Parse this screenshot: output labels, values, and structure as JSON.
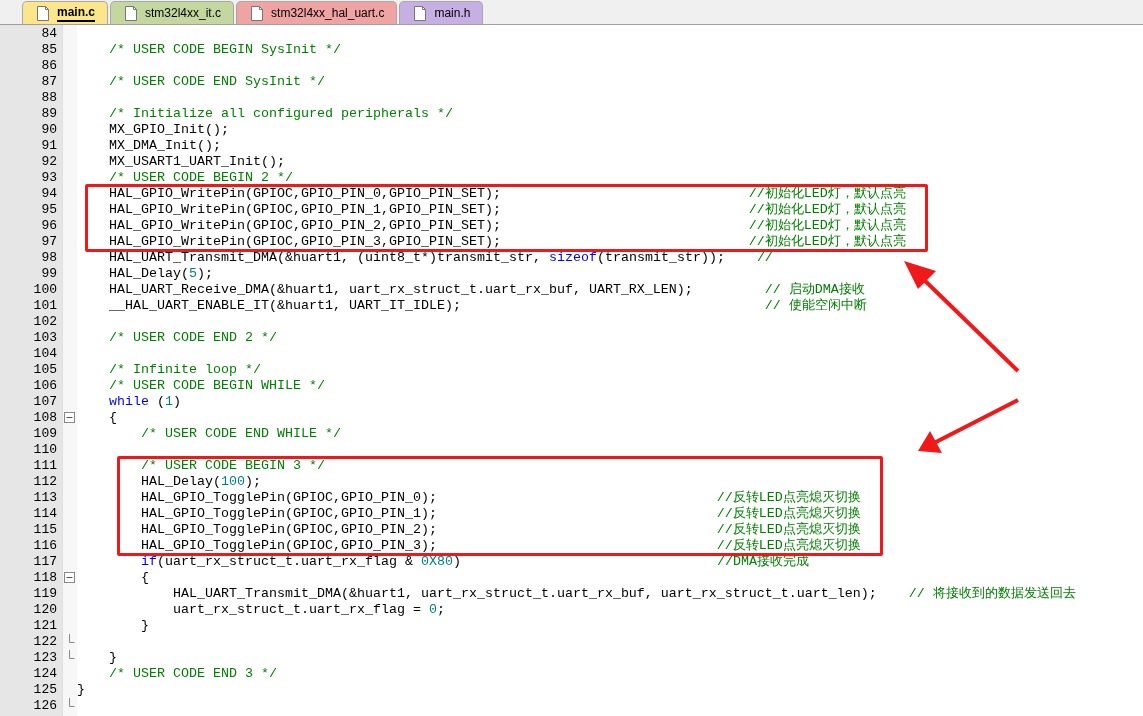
{
  "tabs": [
    {
      "label": "main.c",
      "selected": true,
      "color": "#fce68b"
    },
    {
      "label": "stm32l4xx_it.c",
      "selected": false,
      "color": "#c4d79f"
    },
    {
      "label": "stm32l4xx_hal_uart.c",
      "selected": false,
      "color": "#f0a3a3"
    },
    {
      "label": "main.h",
      "selected": false,
      "color": "#c6afe3"
    }
  ],
  "editor": {
    "lines": [
      {
        "number": "84",
        "highlighted": false
      },
      {
        "number": "85",
        "highlighted": false,
        "tokens": [
          {
            "kind": "comment",
            "text": "    /* USER CODE BEGIN SysInit */"
          }
        ]
      },
      {
        "number": "86",
        "highlighted": false
      },
      {
        "number": "87",
        "highlighted": false,
        "tokens": [
          {
            "kind": "comment",
            "text": "    /* USER CODE END SysInit */"
          }
        ]
      },
      {
        "number": "88",
        "highlighted": false
      },
      {
        "number": "89",
        "highlighted": false,
        "tokens": [
          {
            "kind": "comment",
            "text": "    /* Initialize all configured peripherals */"
          }
        ]
      },
      {
        "number": "90",
        "highlighted": false,
        "tokens": [
          {
            "kind": "code",
            "text": "    MX_GPIO_Init();"
          }
        ]
      },
      {
        "number": "91",
        "highlighted": false,
        "tokens": [
          {
            "kind": "code",
            "text": "    MX_DMA_Init();"
          }
        ]
      },
      {
        "number": "92",
        "highlighted": false,
        "tokens": [
          {
            "kind": "code",
            "text": "    MX_USART1_UART_Init();"
          }
        ]
      },
      {
        "number": "93",
        "highlighted": false,
        "tokens": [
          {
            "kind": "comment",
            "text": "    /* USER CODE BEGIN 2 */"
          }
        ]
      },
      {
        "number": "94",
        "highlighted": true,
        "tokens": [
          {
            "kind": "code",
            "text": "    HAL_GPIO_WritePin(GPIOC,GPIO_PIN_0,GPIO_PIN_SET);                               "
          },
          {
            "kind": "comment",
            "text": "//初始化LED灯，默认点亮"
          }
        ]
      },
      {
        "number": "95",
        "highlighted": true,
        "tokens": [
          {
            "kind": "code",
            "text": "    HAL_GPIO_WritePin(GPIOC,GPIO_PIN_1,GPIO_PIN_SET);                               "
          },
          {
            "kind": "comment",
            "text": "//初始化LED灯，默认点亮"
          }
        ]
      },
      {
        "number": "96",
        "highlighted": true,
        "tokens": [
          {
            "kind": "code",
            "text": "    HAL_GPIO_WritePin(GPIOC,GPIO_PIN_2,GPIO_PIN_SET);                               "
          },
          {
            "kind": "comment",
            "text": "//初始化LED灯，默认点亮"
          }
        ]
      },
      {
        "number": "97",
        "highlighted": true,
        "tokens": [
          {
            "kind": "code",
            "text": "    HAL_GPIO_WritePin(GPIOC,GPIO_PIN_3,GPIO_PIN_SET);                               "
          },
          {
            "kind": "comment",
            "text": "//初始化LED灯，默认点亮"
          }
        ]
      },
      {
        "number": "98",
        "highlighted": false,
        "tokens": [
          {
            "kind": "code",
            "text": "    HAL_UART_Transmit_DMA(&huart1, (uint8_t*)transmit_str, "
          },
          {
            "kind": "keyword",
            "text": "sizeof"
          },
          {
            "kind": "code",
            "text": "(transmit_str));    "
          },
          {
            "kind": "comment",
            "text": "//"
          }
        ]
      },
      {
        "number": "99",
        "highlighted": false,
        "tokens": [
          {
            "kind": "code",
            "text": "    HAL_Delay("
          },
          {
            "kind": "number",
            "text": "5"
          },
          {
            "kind": "code",
            "text": ");"
          }
        ]
      },
      {
        "number": "100",
        "highlighted": false,
        "tokens": [
          {
            "kind": "code",
            "text": "    HAL_UART_Receive_DMA(&huart1, uart_rx_struct_t.uart_rx_buf, UART_RX_LEN);         "
          },
          {
            "kind": "comment",
            "text": "// 启动DMA接收"
          }
        ]
      },
      {
        "number": "101",
        "highlighted": false,
        "tokens": [
          {
            "kind": "code",
            "text": "    __HAL_UART_ENABLE_IT(&huart1, UART_IT_IDLE);                                      "
          },
          {
            "kind": "comment",
            "text": "// 使能空闲中断"
          }
        ]
      },
      {
        "number": "102",
        "highlighted": false
      },
      {
        "number": "103",
        "highlighted": false,
        "tokens": [
          {
            "kind": "comment",
            "text": "    /* USER CODE END 2 */"
          }
        ]
      },
      {
        "number": "104",
        "highlighted": false
      },
      {
        "number": "105",
        "highlighted": false,
        "tokens": [
          {
            "kind": "comment",
            "text": "    /* Infinite loop */"
          }
        ]
      },
      {
        "number": "106",
        "highlighted": false,
        "tokens": [
          {
            "kind": "comment",
            "text": "    /* USER CODE BEGIN WHILE */"
          }
        ]
      },
      {
        "number": "107",
        "highlighted": false,
        "tokens": [
          {
            "kind": "keyword",
            "text": "    while"
          },
          {
            "kind": "code",
            "text": " ("
          },
          {
            "kind": "number",
            "text": "1"
          },
          {
            "kind": "code",
            "text": ")"
          }
        ]
      },
      {
        "number": "108",
        "highlighted": false,
        "collapsible": true,
        "tokens": [
          {
            "kind": "code",
            "text": "    {"
          }
        ]
      },
      {
        "number": "109",
        "highlighted": false,
        "tokens": [
          {
            "kind": "comment",
            "text": "        /* USER CODE END WHILE */"
          }
        ]
      },
      {
        "number": "110",
        "highlighted": false
      },
      {
        "number": "111",
        "highlighted": true,
        "tokens": [
          {
            "kind": "comment",
            "text": "        /* USER CODE BEGIN 3 */"
          }
        ]
      },
      {
        "number": "112",
        "highlighted": true,
        "tokens": [
          {
            "kind": "code",
            "text": "        HAL_Delay("
          },
          {
            "kind": "number",
            "text": "100"
          },
          {
            "kind": "code",
            "text": ");"
          }
        ]
      },
      {
        "number": "113",
        "highlighted": true,
        "tokens": [
          {
            "kind": "code",
            "text": "        HAL_GPIO_TogglePin(GPIOC,GPIO_PIN_0);                                   "
          },
          {
            "kind": "comment",
            "text": "//反转LED点亮熄灭切换"
          }
        ]
      },
      {
        "number": "114",
        "highlighted": true,
        "tokens": [
          {
            "kind": "code",
            "text": "        HAL_GPIO_TogglePin(GPIOC,GPIO_PIN_1);                                   "
          },
          {
            "kind": "comment",
            "text": "//反转LED点亮熄灭切换"
          }
        ]
      },
      {
        "number": "115",
        "highlighted": true,
        "tokens": [
          {
            "kind": "code",
            "text": "        HAL_GPIO_TogglePin(GPIOC,GPIO_PIN_2);                                   "
          },
          {
            "kind": "comment",
            "text": "//反转LED点亮熄灭切换"
          }
        ]
      },
      {
        "number": "116",
        "highlighted": true,
        "tokens": [
          {
            "kind": "code",
            "text": "        HAL_GPIO_TogglePin(GPIOC,GPIO_PIN_3);                                   "
          },
          {
            "kind": "comment",
            "text": "//反转LED点亮熄灭切换"
          }
        ]
      },
      {
        "number": "117",
        "highlighted": false,
        "tokens": [
          {
            "kind": "keyword",
            "text": "        if"
          },
          {
            "kind": "code",
            "text": "(uart_rx_struct_t.uart_rx_flag & "
          },
          {
            "kind": "number",
            "text": "0X80"
          },
          {
            "kind": "code",
            "text": ")                                "
          },
          {
            "kind": "comment",
            "text": "//DMA接收完成"
          }
        ]
      },
      {
        "number": "118",
        "highlighted": false,
        "collapsible": true,
        "tokens": [
          {
            "kind": "code",
            "text": "        {"
          }
        ]
      },
      {
        "number": "119",
        "highlighted": false,
        "tokens": [
          {
            "kind": "code",
            "text": "            HAL_UART_Transmit_DMA(&huart1, uart_rx_struct_t.uart_rx_buf, uart_rx_struct_t.uart_len);    "
          },
          {
            "kind": "comment",
            "text": "// 将接收到的数据发送回去"
          }
        ]
      },
      {
        "number": "120",
        "highlighted": false,
        "tokens": [
          {
            "kind": "code",
            "text": "            uart_rx_struct_t.uart_rx_flag = "
          },
          {
            "kind": "number",
            "text": "0"
          },
          {
            "kind": "code",
            "text": ";"
          }
        ]
      },
      {
        "number": "121",
        "highlighted": false,
        "tokens": [
          {
            "kind": "code",
            "text": "        }"
          }
        ]
      },
      {
        "number": "122",
        "highlighted": false,
        "block_end": true
      },
      {
        "number": "123",
        "highlighted": false,
        "block_end": true,
        "tokens": [
          {
            "kind": "code",
            "text": "    }"
          }
        ]
      },
      {
        "number": "124",
        "highlighted": false,
        "tokens": [
          {
            "kind": "comment",
            "text": "    /* USER CODE END 3 */"
          }
        ]
      },
      {
        "number": "125",
        "highlighted": false,
        "tokens": [
          {
            "kind": "code",
            "text": "}"
          }
        ]
      },
      {
        "number": "126",
        "highlighted": false,
        "block_end": true
      }
    ]
  }
}
